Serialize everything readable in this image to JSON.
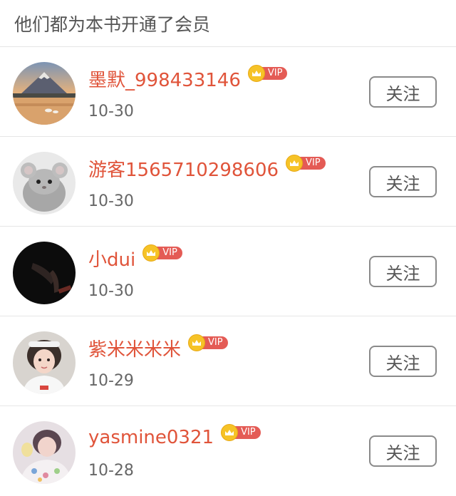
{
  "header": {
    "title": "他们都为本书开通了会员"
  },
  "vip_label": "VIP",
  "follow_label": "关注",
  "colors": {
    "name": "#e0543a",
    "vip_tag": "#e45b55",
    "crown": "#f6c327",
    "divider": "#e6e6e6"
  },
  "members": [
    {
      "name": "墨默_998433146",
      "date": "10-30",
      "avatar_icon": "landscape-avatar-icon"
    },
    {
      "name": "游客1565710298606",
      "date": "10-30",
      "avatar_icon": "chinchilla-avatar-icon"
    },
    {
      "name": "小dui",
      "date": "10-30",
      "avatar_icon": "dark-hand-avatar-icon"
    },
    {
      "name": "紫米米米米",
      "date": "10-29",
      "avatar_icon": "girl-avatar-icon"
    },
    {
      "name": "yasmine0321",
      "date": "10-28",
      "avatar_icon": "child-avatar-icon"
    }
  ]
}
